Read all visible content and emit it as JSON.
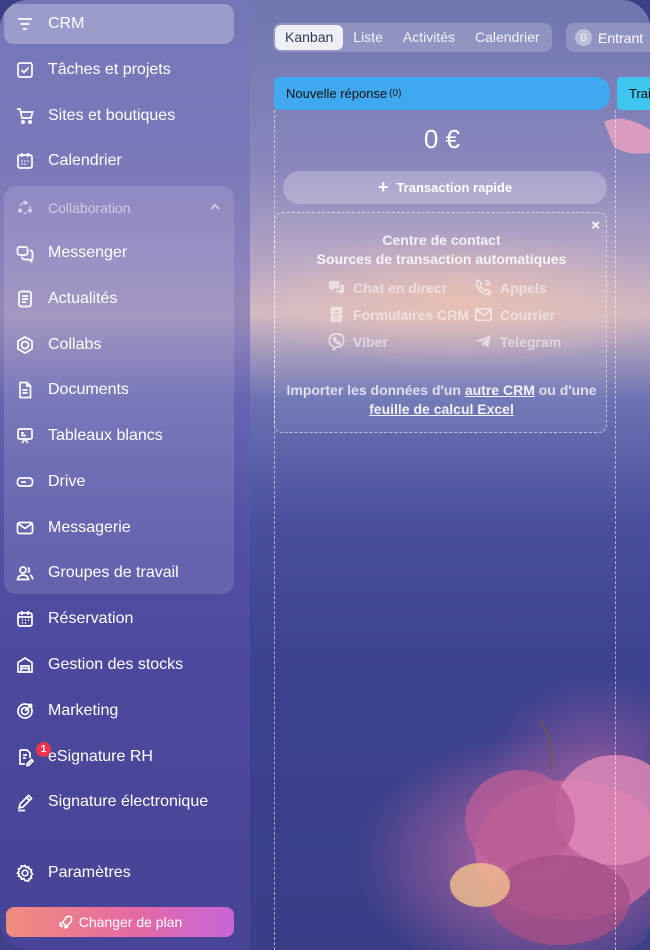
{
  "sidebar": {
    "items_top": [
      {
        "label": "CRM",
        "icon": "filter-lines-icon",
        "active": true
      },
      {
        "label": "Tâches et projets",
        "icon": "checkbox-icon"
      },
      {
        "label": "Sites et boutiques",
        "icon": "cart-icon"
      },
      {
        "label": "Calendrier",
        "icon": "calendar-icon"
      }
    ],
    "group": {
      "label": "Collaboration",
      "icon": "collaboration-icon",
      "items": [
        {
          "label": "Messenger",
          "icon": "chat-icon"
        },
        {
          "label": "Actualités",
          "icon": "news-icon"
        },
        {
          "label": "Collabs",
          "icon": "hexagon-icon"
        },
        {
          "label": "Documents",
          "icon": "document-icon"
        },
        {
          "label": "Tableaux blancs",
          "icon": "whiteboard-icon"
        },
        {
          "label": "Drive",
          "icon": "drive-icon"
        },
        {
          "label": "Messagerie",
          "icon": "envelope-icon"
        },
        {
          "label": "Groupes de travail",
          "icon": "people-icon"
        }
      ]
    },
    "items_bottom": [
      {
        "label": "Réservation",
        "icon": "booking-icon"
      },
      {
        "label": "Gestion des stocks",
        "icon": "warehouse-icon"
      },
      {
        "label": "Marketing",
        "icon": "target-icon"
      },
      {
        "label": "eSignature RH",
        "icon": "esign-doc-icon",
        "badge": "1"
      },
      {
        "label": "Signature électronique",
        "icon": "pen-icon"
      }
    ],
    "settings": {
      "label": "Paramètres",
      "icon": "gear-icon"
    },
    "upgrade_label": "Changer de plan"
  },
  "tabs": [
    {
      "label": "Kanban",
      "active": true
    },
    {
      "label": "Liste"
    },
    {
      "label": "Activités"
    },
    {
      "label": "Calendrier"
    }
  ],
  "incoming": {
    "count": "0",
    "label": "Entrant"
  },
  "column": {
    "title": "Nouvelle réponse",
    "count": "(0)",
    "total": "0 €",
    "quick_add_label": "Transaction rapide",
    "accent": "#3fa8ee"
  },
  "next_column": {
    "title": "Traitement",
    "accent": "#3fc6ee"
  },
  "contact_center": {
    "title": "Centre de contact",
    "subtitle": "Sources de transaction automatiques",
    "close": "×",
    "sources": [
      {
        "label": "Chat en direct",
        "icon": "chat-bubbles-icon"
      },
      {
        "label": "Appels",
        "icon": "phone-icon"
      },
      {
        "label": "Formulaires CRM",
        "icon": "form-icon"
      },
      {
        "label": "Courrier",
        "icon": "mail-icon"
      },
      {
        "label": "Viber",
        "icon": "viber-icon"
      },
      {
        "label": "Telegram",
        "icon": "telegram-icon"
      }
    ],
    "import_prefix": "Importer les données d'un ",
    "import_link1": "autre CRM",
    "import_mid": " ou d'une",
    "import_link2": "feuille de calcul Excel"
  }
}
